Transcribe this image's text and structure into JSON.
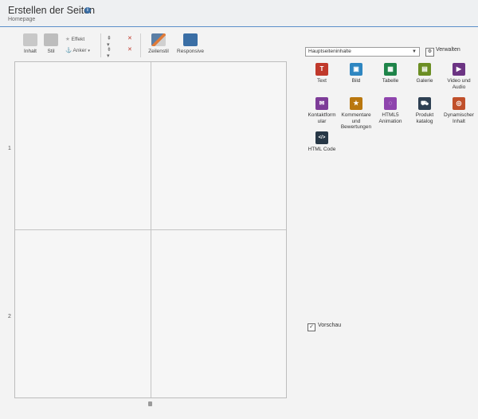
{
  "header": {
    "title": "Erstellen der Seiten",
    "subtitle": "Homepage",
    "info": "i"
  },
  "toolbar": {
    "inhalt": "Inhalt",
    "stil": "Stil",
    "effekt": "Effekt",
    "anker": "Anker",
    "zeilenstil": "Zeilenstil",
    "responsive": "Responsive"
  },
  "grid": {
    "row_labels": [
      "1",
      "2"
    ]
  },
  "panel": {
    "select_value": "Hauptseiteninhalte",
    "manage": "Verwalten",
    "tiles": [
      {
        "label": "Text",
        "color": "#c0392b",
        "icon": "text-icon"
      },
      {
        "label": "Bild",
        "color": "#2e86c1",
        "icon": "image-icon"
      },
      {
        "label": "Tabelle",
        "color": "#1e8449",
        "icon": "table-icon"
      },
      {
        "label": "Galerie",
        "color": "#6b8e23",
        "icon": "gallery-icon"
      },
      {
        "label": "Video und Audio",
        "color": "#6c3483",
        "icon": "video-icon"
      },
      {
        "label": "Kontaktform ular",
        "color": "#7d3c98",
        "icon": "mail-icon"
      },
      {
        "label": "Kommentare und Bewertungen",
        "color": "#b9770e",
        "icon": "star-icon"
      },
      {
        "label": "HTML5 Animation",
        "color": "#8e44ad",
        "icon": "animation-icon"
      },
      {
        "label": "Produkt katalog",
        "color": "#2e4053",
        "icon": "cart-icon"
      },
      {
        "label": "Dynamischer Inhalt",
        "color": "#c0502b",
        "icon": "dynamic-icon"
      },
      {
        "label": "HTML Code",
        "color": "#273746",
        "icon": "code-icon"
      }
    ],
    "preview": "Vorschau"
  }
}
